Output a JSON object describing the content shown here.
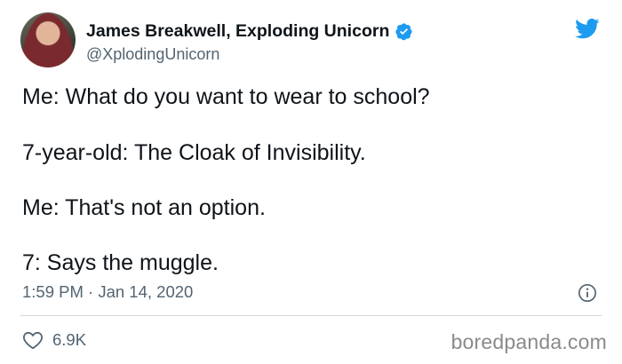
{
  "tweet": {
    "author_name": "James Breakwell, Exploding Unicorn",
    "handle": "@XplodingUnicorn",
    "lines": [
      "Me: What do you want to wear to school?",
      "7-year-old: The Cloak of Invisibility.",
      "Me: That's not an option.",
      "7: Says the muggle."
    ],
    "timestamp": "1:59 PM · Jan 14, 2020",
    "likes": "6.9K"
  },
  "watermark": "boredpanda.com",
  "icons": {
    "verified": "verified-badge-icon",
    "brand": "twitter-bird-icon",
    "info": "info-icon",
    "like": "heart-icon"
  },
  "colors": {
    "twitter_blue": "#1d9bf0",
    "text": "#0f1419",
    "muted": "#536471",
    "divider": "#cfd9de"
  }
}
